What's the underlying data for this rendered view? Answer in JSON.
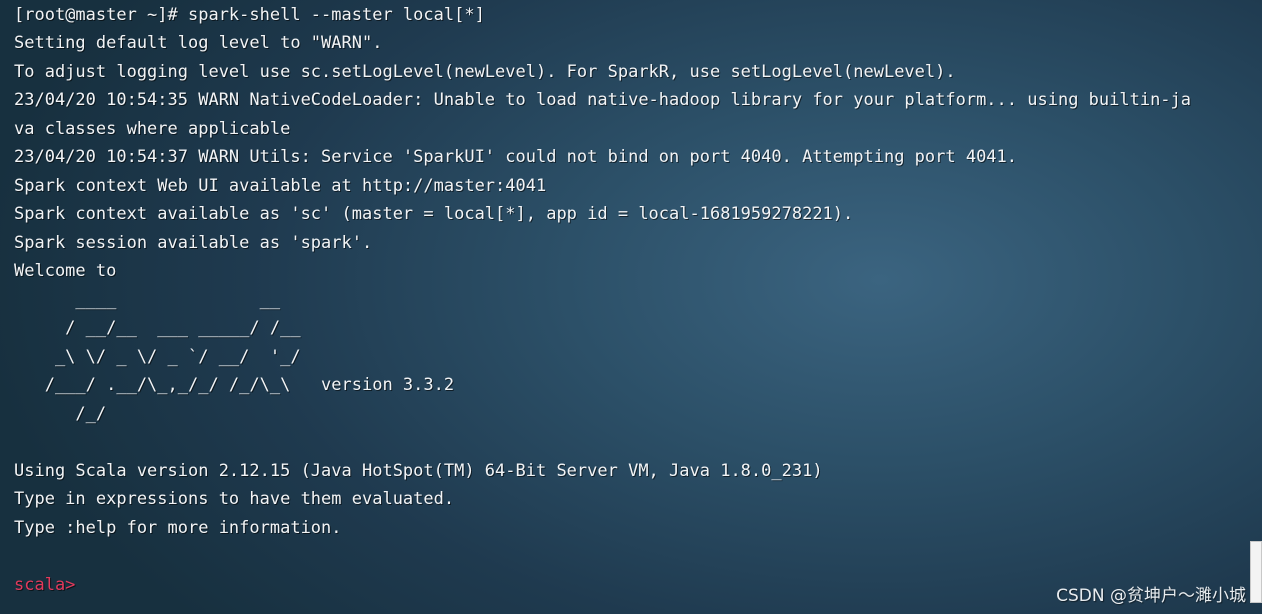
{
  "terminal": {
    "lines": [
      "[root@master ~]# spark-shell --master local[*]",
      "Setting default log level to \"WARN\".",
      "To adjust logging level use sc.setLogLevel(newLevel). For SparkR, use setLogLevel(newLevel).",
      "23/04/20 10:54:35 WARN NativeCodeLoader: Unable to load native-hadoop library for your platform... using builtin-ja",
      "va classes where applicable",
      "23/04/20 10:54:37 WARN Utils: Service 'SparkUI' could not bind on port 4040. Attempting port 4041.",
      "Spark context Web UI available at http://master:4041",
      "Spark context available as 'sc' (master = local[*], app id = local-1681959278221).",
      "Spark session available as 'spark'.",
      "Welcome to",
      "      ____              __",
      "     / __/__  ___ _____/ /__",
      "    _\\ \\/ _ \\/ _ `/ __/  '_/",
      "   /___/ .__/\\_,_/_/ /_/\\_\\   version 3.3.2",
      "      /_/",
      "",
      "Using Scala version 2.12.15 (Java HotSpot(TM) 64-Bit Server VM, Java 1.8.0_231)",
      "Type in expressions to have them evaluated.",
      "Type :help for more information.",
      "",
      "scala>"
    ],
    "prompt_color": "#e23a5c",
    "text_color": "#f2f4f6",
    "background_color": "#2c5068"
  },
  "watermark": {
    "text": "CSDN @贫坤户～濉小城"
  }
}
